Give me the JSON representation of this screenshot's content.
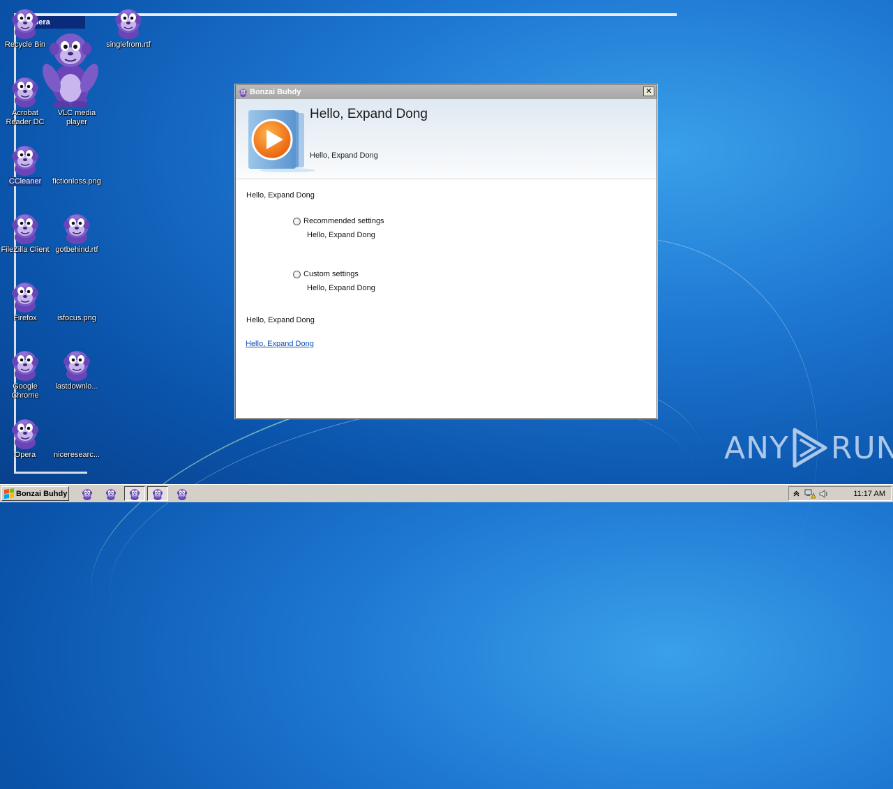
{
  "desktop": {
    "icons": [
      {
        "label": "Recycle Bin"
      },
      {
        "label": "singlefrom.rtf"
      },
      {
        "label": "Acrobat Reader DC"
      },
      {
        "label": "VLC media player"
      },
      {
        "label": "CCleaner"
      },
      {
        "label": "fictionloss.png"
      },
      {
        "label": "FileZilla Client"
      },
      {
        "label": "gotbehind.rtf"
      },
      {
        "label": "Firefox"
      },
      {
        "label": "isfocus.png"
      },
      {
        "label": "Google Chrome"
      },
      {
        "label": "lastdownlo..."
      },
      {
        "label": "Opera"
      },
      {
        "label": "niceresearc..."
      }
    ],
    "opera_window_title": "Opera"
  },
  "dialog": {
    "title": "Bonzai Buhdy",
    "close_label": "✕",
    "banner_title": "Hello, Expand Dong",
    "banner_subtitle": "Hello, Expand Dong",
    "intro_text": "Hello, Expand Dong",
    "option_recommended_label": "Recommended settings",
    "option_recommended_desc": "Hello, Expand Dong",
    "option_custom_label": "Custom settings",
    "option_custom_desc": "Hello, Expand Dong",
    "footer_text": "Hello, Expand Dong",
    "link_text": "Hello, Expand Dong"
  },
  "taskbar": {
    "start_label": "Bonzai Buhdy",
    "clock": "11:17 AM",
    "tray_icons": [
      "chevron-up-icon",
      "network-warning-icon",
      "speaker-icon"
    ]
  },
  "watermark": {
    "left": "ANY",
    "right": "RUN"
  },
  "colors": {
    "mascot_purple": "#7d5bc7",
    "dialog_title_bar": "#aeaeae",
    "link": "#0b4fb5",
    "taskbar": "#d4d0c8"
  }
}
